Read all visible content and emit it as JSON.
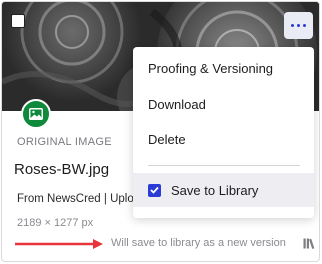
{
  "card": {
    "label": "ORIGINAL IMAGE",
    "filename": "Roses-BW.jpg",
    "source": "From NewsCred | Uplo",
    "dimensions": "2189 × 1277 px",
    "save_note": "Will save to library as a new version",
    "selected": false
  },
  "menu": {
    "items": [
      {
        "label": "Proofing & Versioning"
      },
      {
        "label": "Download"
      },
      {
        "label": "Delete"
      }
    ],
    "save_to_library": {
      "label": "Save to Library",
      "checked": true
    }
  },
  "colors": {
    "accent": "#2a3bd6",
    "badge": "#0f8a3c",
    "arrow": "#e8343d",
    "menu_highlight": "#eeeef2"
  },
  "icons": {
    "select": "checkbox-icon",
    "more": "more-horizontal-icon",
    "type": "image-icon",
    "library": "library-icon"
  }
}
